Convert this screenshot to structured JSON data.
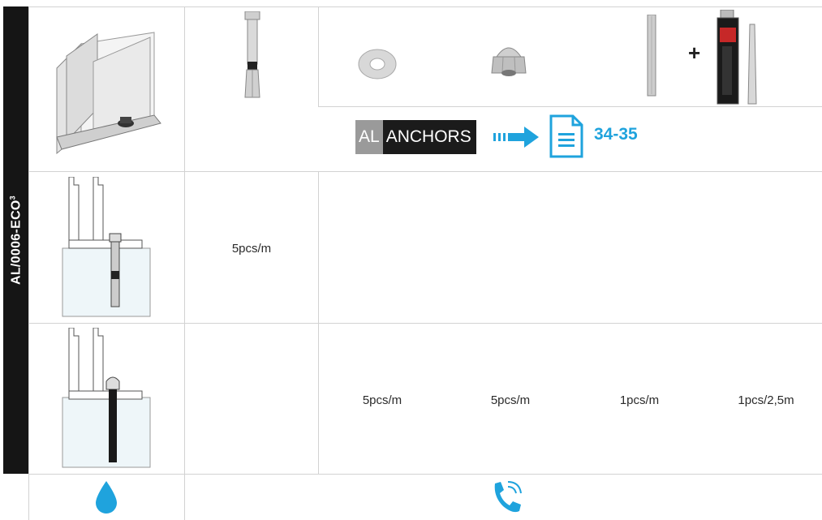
{
  "sidebar": {
    "code": "AL/0006-ECO",
    "superscript": "3"
  },
  "reference": {
    "prefix": "AL",
    "label": "ANCHORS",
    "pages": "34-35"
  },
  "rows": {
    "anchor_qty": "5pcs/m",
    "chemical": {
      "washer_qty": "5pcs/m",
      "nut_qty": "5pcs/m",
      "rod_qty": "1pcs/m",
      "resin_qty": "1pcs/2,5m"
    }
  },
  "footer": {
    "left_icon": "water-drop-icon",
    "right_icon": "phone-icon"
  },
  "colors": {
    "accent": "#1fa3dd",
    "sidebar": "#151515",
    "grid": "#d2d2d2"
  }
}
